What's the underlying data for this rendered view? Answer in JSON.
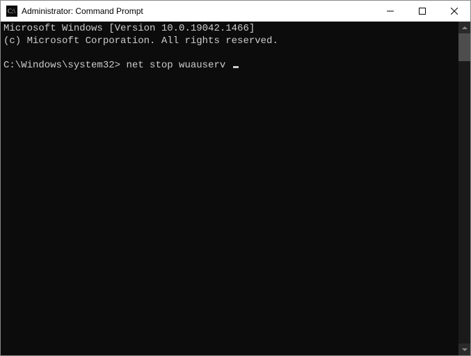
{
  "window": {
    "title": "Administrator: Command Prompt"
  },
  "terminal": {
    "line1": "Microsoft Windows [Version 10.0.19042.1466]",
    "line2": "(c) Microsoft Corporation. All rights reserved.",
    "blank1": "",
    "prompt": "C:\\Windows\\system32>",
    "command": "net stop wuauserv"
  }
}
